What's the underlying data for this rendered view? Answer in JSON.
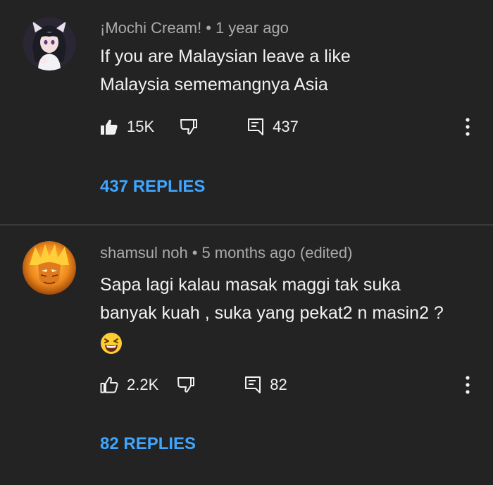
{
  "comments": [
    {
      "author": "¡Mochi Cream!",
      "time": "1 year ago",
      "lines": [
        "If you are Malaysian leave a like",
        "Malaysia sememangnya Asia"
      ],
      "likes": "15K",
      "reply_count": "437",
      "replies_label": "437 REPLIES",
      "liked": true,
      "avatar_icon": "anime-girl-avatar"
    },
    {
      "author": "shamsul noh",
      "time": "5 months ago (edited)",
      "lines": [
        "Sapa lagi kalau masak maggi tak suka",
        "banyak kuah , suka yang pekat2 n masin2 ?"
      ],
      "emoji": "😆",
      "likes": "2.2K",
      "reply_count": "82",
      "replies_label": "82 REPLIES",
      "liked": false,
      "avatar_icon": "anime-hero-avatar"
    }
  ],
  "colors": {
    "background": "#232323",
    "meta": "#aaaaaa",
    "text": "#f1f1f1",
    "link": "#3ea6ff",
    "divider": "#3a3a3a"
  }
}
